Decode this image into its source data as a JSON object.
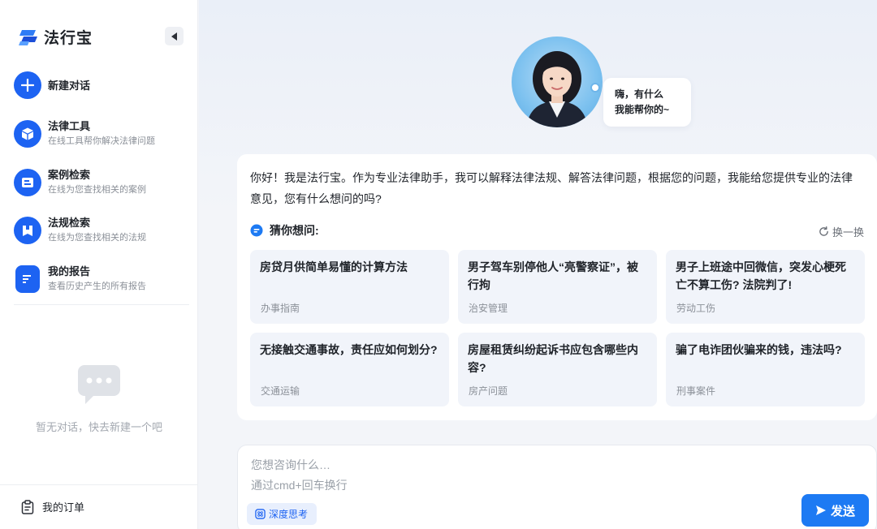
{
  "app": {
    "name": "法行宝"
  },
  "sidebar": {
    "new_chat": {
      "label": "新建对话"
    },
    "items": [
      {
        "title": "法律工具",
        "subtitle": "在线工具帮你解决法律问题"
      },
      {
        "title": "案例检索",
        "subtitle": "在线为您查找相关的案例"
      },
      {
        "title": "法规检索",
        "subtitle": "在线为您查找相关的法规"
      },
      {
        "title": "我的报告",
        "subtitle": "查看历史产生的所有报告"
      }
    ],
    "empty_text": "暂无对话，快去新建一个吧",
    "orders_label": "我的订单"
  },
  "greeting": {
    "line1": "嗨，有什么",
    "line2": "我能帮你的~"
  },
  "intro": "你好！我是法行宝。作为专业法律助手，我可以解释法律法规、解答法律问题，根据您的问题，我能给您提供专业的法律意见，您有什么想问的吗?",
  "suggestions": {
    "title": "猜你想问:",
    "refresh_label": "换一换",
    "items": [
      {
        "title": "房贷月供简单易懂的计算方法",
        "tag": "办事指南"
      },
      {
        "title": "男子驾车别停他人“亮警察证”，被行拘",
        "tag": "治安管理"
      },
      {
        "title": "男子上班途中回微信，突发心梗死亡不算工伤? 法院判了!",
        "tag": "劳动工伤"
      },
      {
        "title": "无接触交通事故，责任应如何划分?",
        "tag": "交通运输"
      },
      {
        "title": "房屋租赁纠纷起诉书应包含哪些内容?",
        "tag": "房产问题"
      },
      {
        "title": "骗了电诈团伙骗来的钱，违法吗?",
        "tag": "刑事案件"
      }
    ]
  },
  "input": {
    "placeholder": "您想咨询什么…\n通过cmd+回车换行",
    "deep_think_label": "深度思考",
    "send_label": "发送"
  },
  "colors": {
    "accent": "#1d63f2",
    "send": "#1d7af3",
    "card_bg": "#f1f4fa"
  }
}
